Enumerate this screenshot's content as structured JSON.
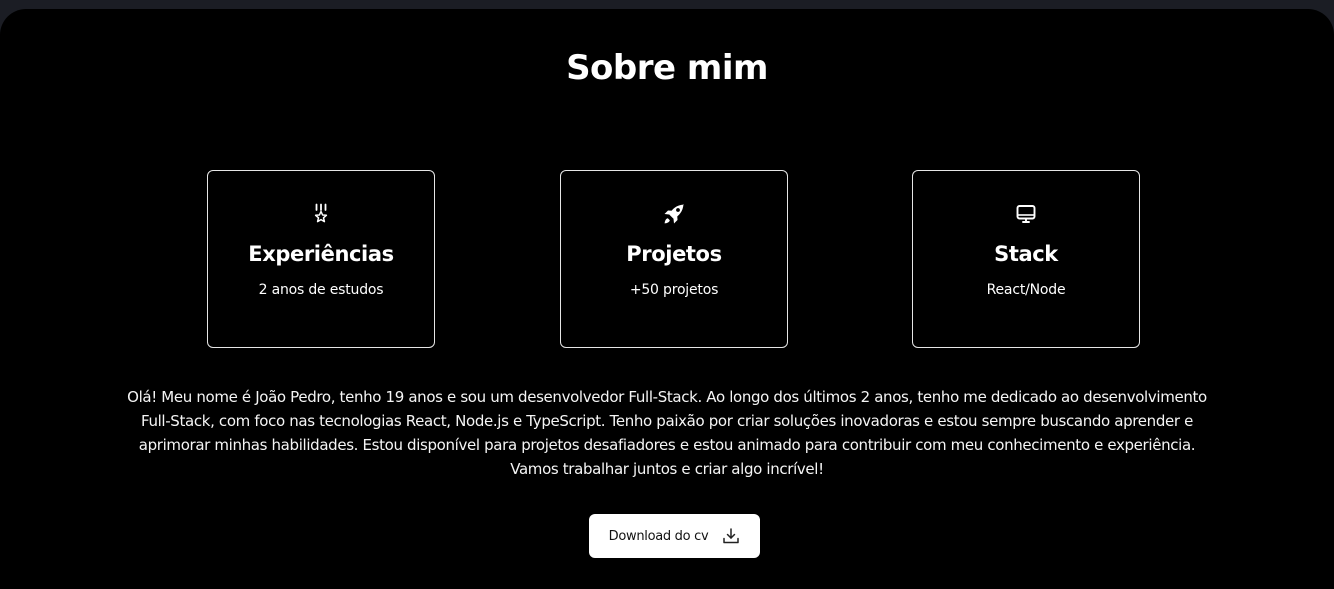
{
  "about": {
    "title": "Sobre mim",
    "cards": [
      {
        "icon": "medal-icon",
        "title": "Experiências",
        "subtitle": "2 anos de estudos"
      },
      {
        "icon": "rocket-icon",
        "title": "Projetos",
        "subtitle": "+50 projetos"
      },
      {
        "icon": "monitor-icon",
        "title": "Stack",
        "subtitle": "React/Node"
      }
    ],
    "description": "Olá! Meu nome é João Pedro, tenho 19 anos e sou um desenvolvedor Full-Stack. Ao longo dos últimos 2 anos, tenho me dedicado ao desenvolvimento Full-Stack, com foco nas tecnologias React, Node.js e TypeScript. Tenho paixão por criar soluções inovadoras e estou sempre buscando aprender e aprimorar minhas habilidades. Estou disponível para projetos desafiadores e estou animado para contribuir com meu conhecimento e experiência. Vamos trabalhar juntos e criar algo incrível!",
    "download_button": {
      "label": "Download do cv",
      "icon": "download-icon"
    }
  },
  "colors": {
    "page_background": "#1b1d24",
    "section_background": "#000000",
    "text": "#ffffff",
    "card_border": "#e6e6e6",
    "button_background": "#ffffff",
    "button_text": "#111111"
  }
}
